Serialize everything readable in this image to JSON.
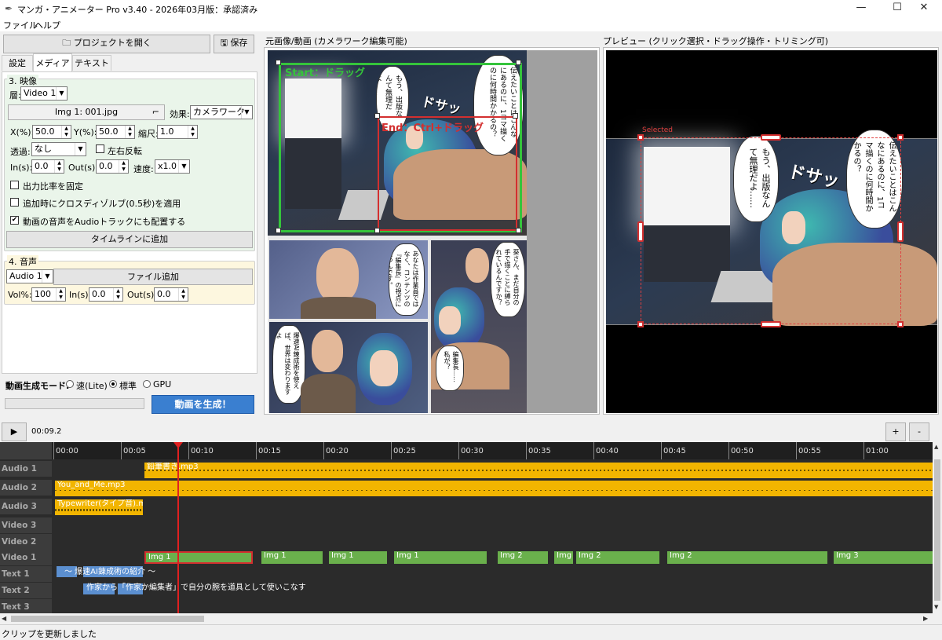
{
  "window": {
    "title": "マンガ・アニメーター Pro v3.40 - 2026年03月版：承認済み",
    "minimize": "—",
    "maximize": "☐",
    "close": "✕"
  },
  "menu": [
    "ファイル",
    "ヘルプ"
  ],
  "left": {
    "open_project": "プロジェクトを開く",
    "save": "保存",
    "tabs": [
      "設定",
      "メディア",
      "テキスト"
    ],
    "video_group": {
      "title": "3. 映像",
      "layer_label": "層:",
      "layer_value": "Video 1",
      "image_value": "Img 1: 001.jpg",
      "effect_label": "効果:",
      "effect_value": "カメラワーク",
      "x_label": "X(%):",
      "x_value": "50.0",
      "y_label": "Y(%):",
      "y_value": "50.0",
      "scale_label": "縮尺:",
      "scale_value": "1.0",
      "transparency_label": "透過:",
      "transparency_value": "なし",
      "flip_label": "左右反転",
      "in_label": "In(s):",
      "in_value": "0.0",
      "out_label": "Out(s):",
      "out_value": "0.0",
      "speed_label": "速度:",
      "speed_value": "x1.0",
      "fixed_ratio_label": "出力比率を固定",
      "crossfade_label": "追加時にクロスディゾルブ(0.5秒)を適用",
      "audio_track_label": "動画の音声をAudioトラックにも配置する",
      "add_timeline": "タイムラインに追加"
    },
    "audio_group": {
      "title": "4. 音声",
      "track_value": "Audio 1",
      "add_file": "ファイル追加",
      "vol_label": "Vol%:",
      "vol_value": "100",
      "in_label": "In(s):",
      "in_value": "0.0",
      "out_label": "Out(s):",
      "out_value": "0.0"
    },
    "gen_mode_label": "動画生成モード:",
    "modes": [
      "速(Lite)",
      "標準",
      "GPU"
    ],
    "generate": "動画を生成！"
  },
  "source_panel": {
    "title": "元画像/動画 (カメラワーク編集可能)",
    "start_label": "Start：ドラッグ",
    "end_label": "End：Ctrl+ドラッグ"
  },
  "preview_panel": {
    "title": "プレビュー (クリック選択・ドラッグ操作・トリミング可)",
    "selected_label": "Selected"
  },
  "manga": {
    "bubble1": "もう、出版なんて無理だよ……",
    "bubble2": "伝えたいことはこんなにあるのに、1コマ描くのに何時間かかるの？",
    "sfx": "ドサッ",
    "bubble3": "あなたは作業員ではなく、コンテンツの『編集長』の視点に立つんです。",
    "bubble4": "葵さん、まだ自分の手で描くことに縛られているんですか？",
    "bubble5": "爆速AI錬成術を使えば、世界は変わりますよ",
    "bubble6": "編集長……私が？"
  },
  "transport": {
    "play": "▶",
    "time": "00:09.2",
    "zoom_in": "+",
    "zoom_out": "-"
  },
  "timeline": {
    "ticks": [
      "00:00",
      "00:05",
      "00:10",
      "00:15",
      "00:20",
      "00:25",
      "00:30",
      "00:35",
      "00:40",
      "00:45",
      "00:50",
      "00:55",
      "01:00"
    ],
    "tracks": [
      "Audio 1",
      "Audio 2",
      "Audio 3",
      "Video 3",
      "Video 2",
      "Video 1",
      "Text 1",
      "Text 2",
      "Text 3"
    ],
    "audio1_clip": "鉛筆書き.mp3",
    "audio2_clip": "You_and_Me.mp3",
    "audio3_clip": "Typewriter(タイプ音).mp3",
    "video_clips": [
      "Img 1",
      "Img 1",
      "Img 1",
      "Img 1",
      "Img 2",
      "Img 2",
      "Img 2",
      "Img 2",
      "Img 3"
    ],
    "text1_clip": "～ 爆速AI錬成術の紹介 ～",
    "text2_clip": "作家から「作家か編集者」で自分の腕を道具として使いこなす"
  },
  "status": "クリップを更新しました"
}
